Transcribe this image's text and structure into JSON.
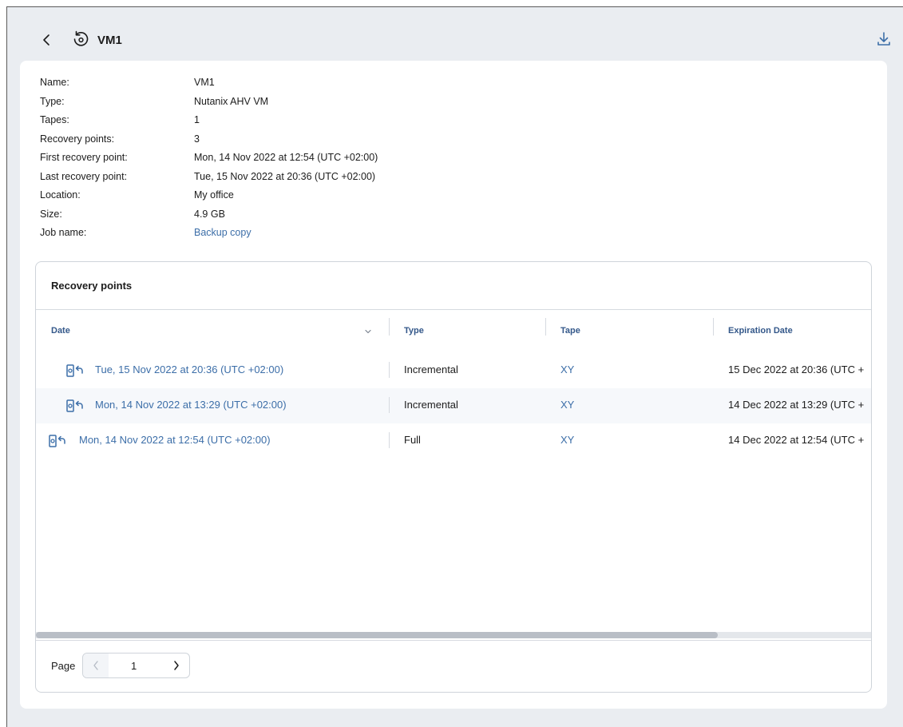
{
  "header": {
    "title": "VM1",
    "back_icon": "chevron-left-icon",
    "vm_icon": "restore-circle-icon",
    "download_icon": "download-icon"
  },
  "properties": [
    {
      "label": "Name:",
      "value": "VM1"
    },
    {
      "label": "Type:",
      "value": "Nutanix AHV VM"
    },
    {
      "label": "Tapes:",
      "value": "1"
    },
    {
      "label": "Recovery points:",
      "value": "3"
    },
    {
      "label": "First recovery point:",
      "value": "Mon, 14 Nov 2022 at 12:54 (UTC +02:00)"
    },
    {
      "label": "Last recovery point:",
      "value": "Tue, 15 Nov 2022 at 20:36 (UTC +02:00)"
    },
    {
      "label": "Location:",
      "value": "My office"
    },
    {
      "label": "Size:",
      "value": "4.9 GB"
    },
    {
      "label": "Job name:",
      "value": "Backup copy"
    }
  ],
  "recovery_points": {
    "title": "Recovery points",
    "columns": [
      "Date",
      "Type",
      "Tape",
      "Expiration Date"
    ],
    "rows": [
      {
        "date": "Tue, 15 Nov 2022 at 20:36 (UTC +02:00)",
        "type": "Incremental",
        "tape": "XY",
        "expiration": "15 Dec 2022 at 20:36 (UTC +"
      },
      {
        "date": "Mon, 14 Nov 2022 at 13:29 (UTC +02:00)",
        "type": "Incremental",
        "tape": "XY",
        "expiration": "14 Dec 2022 at 13:29 (UTC +"
      },
      {
        "date": "Mon, 14 Nov 2022 at 12:54 (UTC +02:00)",
        "type": "Full",
        "tape": "XY",
        "expiration": "14 Dec 2022 at 12:54 (UTC +"
      }
    ],
    "row_icon": "tape-restore-icon"
  },
  "pagination": {
    "label": "Page",
    "current": "1"
  },
  "colors": {
    "link": "#3c6ea8",
    "background": "#eaedf1"
  }
}
